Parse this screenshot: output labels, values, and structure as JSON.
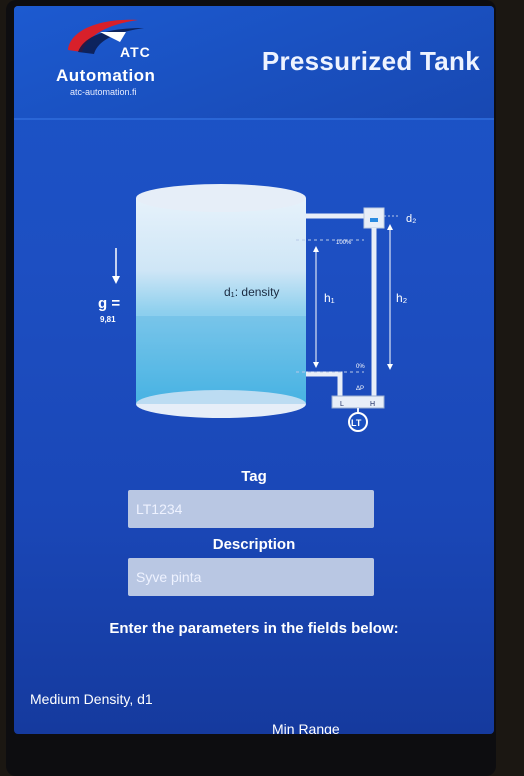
{
  "header": {
    "logo_atc": "ATC",
    "logo_name": "Automation",
    "logo_url": "atc-automation.fi",
    "title": "Pressurized Tank"
  },
  "diagram": {
    "gravity": "g =",
    "gravity_value": "9,81",
    "density_label": "d₁: density",
    "h1": "h₁",
    "h2": "h₂",
    "d2": "d₂",
    "pct_100": "100%",
    "pct_0": "0%",
    "dp": "ΔP",
    "port_low": "L",
    "port_high": "H",
    "transmitter": "LT"
  },
  "form": {
    "tag_label": "Tag",
    "tag_value": "LT1234",
    "description_label": "Description",
    "description_value": "Syve pinta",
    "instructions": "Enter the parameters in the fields below:",
    "medium_density_label": "Medium Density, d1",
    "min_range_label": "Min Range"
  },
  "colors": {
    "screen_blue": "#1a4fc0",
    "tank_fill": "#7ec8e8",
    "field_bg": "#b9c7e3"
  }
}
